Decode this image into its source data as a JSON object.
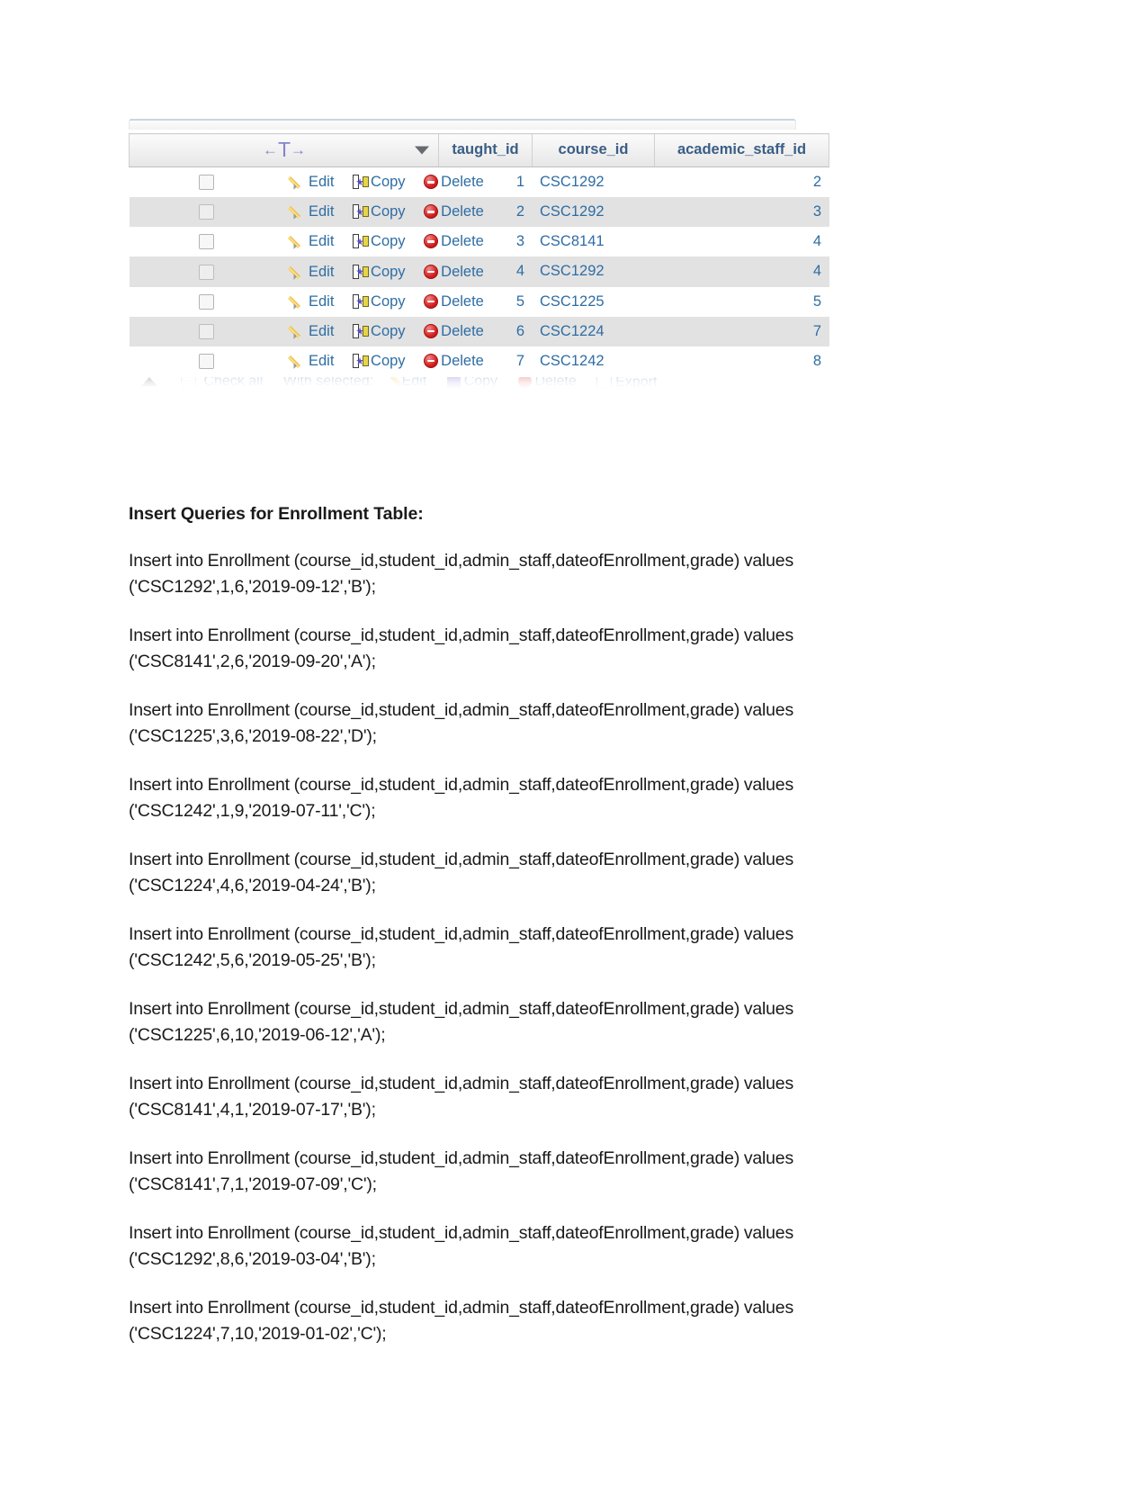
{
  "pma_table": {
    "nav_arrows": {
      "left": "←",
      "t": "T",
      "right": "→"
    },
    "columns": {
      "actions": "",
      "taught_id": "taught_id",
      "course_id": "course_id",
      "academic_staff_id": "academic_staff_id"
    },
    "actions": {
      "edit": "Edit",
      "copy": "Copy",
      "delete": "Delete"
    },
    "rows": [
      {
        "taught_id": "1",
        "course_id": "CSC1292",
        "academic_staff_id": "2"
      },
      {
        "taught_id": "2",
        "course_id": "CSC1292",
        "academic_staff_id": "3"
      },
      {
        "taught_id": "3",
        "course_id": "CSC8141",
        "academic_staff_id": "4"
      },
      {
        "taught_id": "4",
        "course_id": "CSC1292",
        "academic_staff_id": "4"
      },
      {
        "taught_id": "5",
        "course_id": "CSC1225",
        "academic_staff_id": "5"
      },
      {
        "taught_id": "6",
        "course_id": "CSC1224",
        "academic_staff_id": "7"
      },
      {
        "taught_id": "7",
        "course_id": "CSC1242",
        "academic_staff_id": "8"
      }
    ],
    "footer": {
      "check_all": "Check all",
      "with_selected": "With selected:",
      "edit": "Edit",
      "copy": "Copy",
      "delete": "Delete",
      "export": "Export"
    }
  },
  "document": {
    "heading": "Insert Queries for Enrollment Table:",
    "queries": [
      "Insert into Enrollment (course_id,student_id,admin_staff,dateofEnrollment,grade) values ('CSC1292',1,6,'2019-09-12','B');",
      "Insert into Enrollment (course_id,student_id,admin_staff,dateofEnrollment,grade) values ('CSC8141',2,6,'2019-09-20','A');",
      "Insert into Enrollment (course_id,student_id,admin_staff,dateofEnrollment,grade) values ('CSC1225',3,6,'2019-08-22','D');",
      "Insert into Enrollment (course_id,student_id,admin_staff,dateofEnrollment,grade) values ('CSC1242',1,9,'2019-07-11','C');",
      "Insert into Enrollment (course_id,student_id,admin_staff,dateofEnrollment,grade) values ('CSC1224',4,6,'2019-04-24','B');",
      "Insert into Enrollment (course_id,student_id,admin_staff,dateofEnrollment,grade) values ('CSC1242',5,6,'2019-05-25','B');",
      "Insert into Enrollment (course_id,student_id,admin_staff,dateofEnrollment,grade) values ('CSC1225',6,10,'2019-06-12','A');",
      "Insert into Enrollment (course_id,student_id,admin_staff,dateofEnrollment,grade) values ('CSC8141',4,1,'2019-07-17','B');",
      "Insert into Enrollment (course_id,student_id,admin_staff,dateofEnrollment,grade) values ('CSC8141',7,1,'2019-07-09','C');",
      "Insert into Enrollment (course_id,student_id,admin_staff,dateofEnrollment,grade) values ('CSC1292',8,6,'2019-03-04','B');",
      "Insert into Enrollment (course_id,student_id,admin_staff,dateofEnrollment,grade) values ('CSC1224',7,10,'2019-01-02','C');"
    ]
  },
  "colors": {
    "link_blue": "#2e6da4",
    "header_blue": "#3a5e86",
    "row_alt": "#e2e2e2",
    "delete_red": "#d31f1f",
    "pencil_yellow": "#f0c040",
    "copy_purple": "#5b4fc0"
  }
}
